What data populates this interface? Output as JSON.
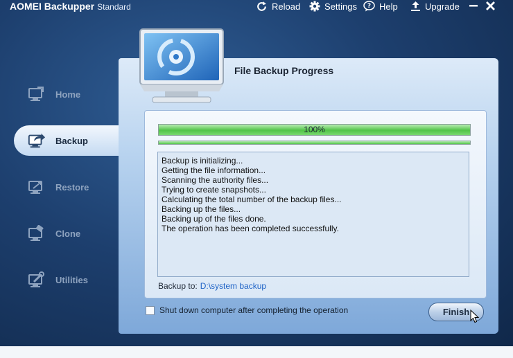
{
  "window": {
    "app_name": "AOMEI Backupper",
    "edition": "Standard"
  },
  "toolbar": {
    "reload": "Reload",
    "settings": "Settings",
    "help": "Help",
    "upgrade": "Upgrade"
  },
  "sidebar": {
    "items": [
      {
        "label": "Home",
        "icon": "home-computer-icon",
        "active": false
      },
      {
        "label": "Backup",
        "icon": "backup-icon",
        "active": true
      },
      {
        "label": "Restore",
        "icon": "restore-icon",
        "active": false
      },
      {
        "label": "Clone",
        "icon": "clone-icon",
        "active": false
      },
      {
        "label": "Utilities",
        "icon": "utilities-icon",
        "active": false
      }
    ]
  },
  "main": {
    "title": "File Backup Progress",
    "progress": {
      "percent_label": "100%",
      "value": 100,
      "sub_value": 100
    },
    "log": [
      "Backup is initializing...",
      "Getting the file information...",
      "Scanning the authority files...",
      "Trying to create snapshots...",
      "Calculating the total number of the backup files...",
      "Backing up the files...",
      "Backing up of the files done.",
      "The operation has been completed successfully."
    ],
    "backup_to_label": "Backup to:",
    "backup_to_path": "D:\\system backup",
    "shutdown_label": "Shut down computer after completing the operation",
    "shutdown_checked": false,
    "finish_label": "Finish"
  },
  "colors": {
    "background": "#1d3f6e",
    "progress_green": "#52c448",
    "path_blue": "#1f63c6"
  }
}
